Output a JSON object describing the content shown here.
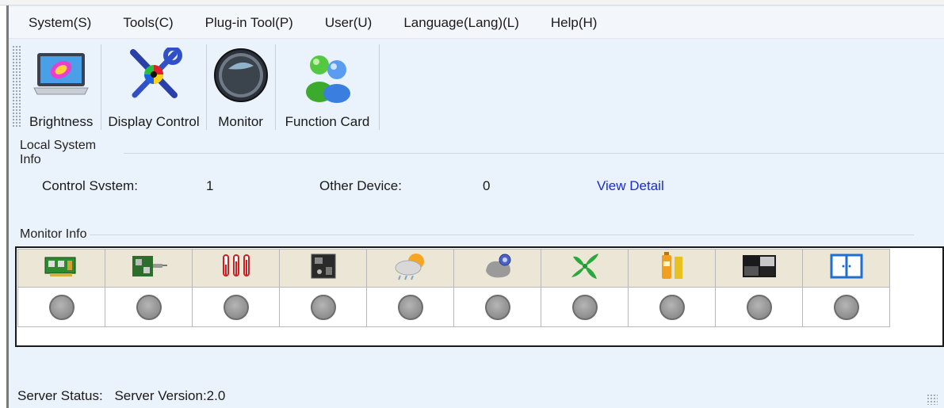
{
  "menu": [
    "System(S)",
    "Tools(C)",
    "Plug-in Tool(P)",
    "User(U)",
    "Language(Lang)(L)",
    "Help(H)"
  ],
  "toolbar": [
    {
      "label": "Brightness",
      "icon": "laptop-brightness-icon"
    },
    {
      "label": "Display Control",
      "icon": "tools-color-wheel-icon"
    },
    {
      "label": "Monitor",
      "icon": "monitor-dome-icon"
    },
    {
      "label": "Function Card",
      "icon": "users-icon"
    }
  ],
  "local_info": {
    "title": "Local System Info",
    "control_system_label": "Control Svstem:",
    "control_system_value": "1",
    "other_device_label": "Other Device:",
    "other_device_value": "0",
    "view_detail": "View Detail"
  },
  "monitor_info": {
    "title": "Monitor Info",
    "columns": [
      "receiving-card-icon",
      "network-card-icon",
      "temperature-icon",
      "circuit-board-icon",
      "weather-icon",
      "smoke-sensor-icon",
      "fan-icon",
      "power-supply-icon",
      "screen-module-icon",
      "cabinet-door-icon"
    ],
    "status_colors": {
      "dot": "#9e9e9e"
    }
  },
  "status_bar": {
    "label": "Server Status:",
    "version": "Server Version:2.0"
  },
  "colors": {
    "window_bg": "#eaf2fb",
    "link": "#1a2bd6",
    "header_cell": "#ece6d6"
  }
}
